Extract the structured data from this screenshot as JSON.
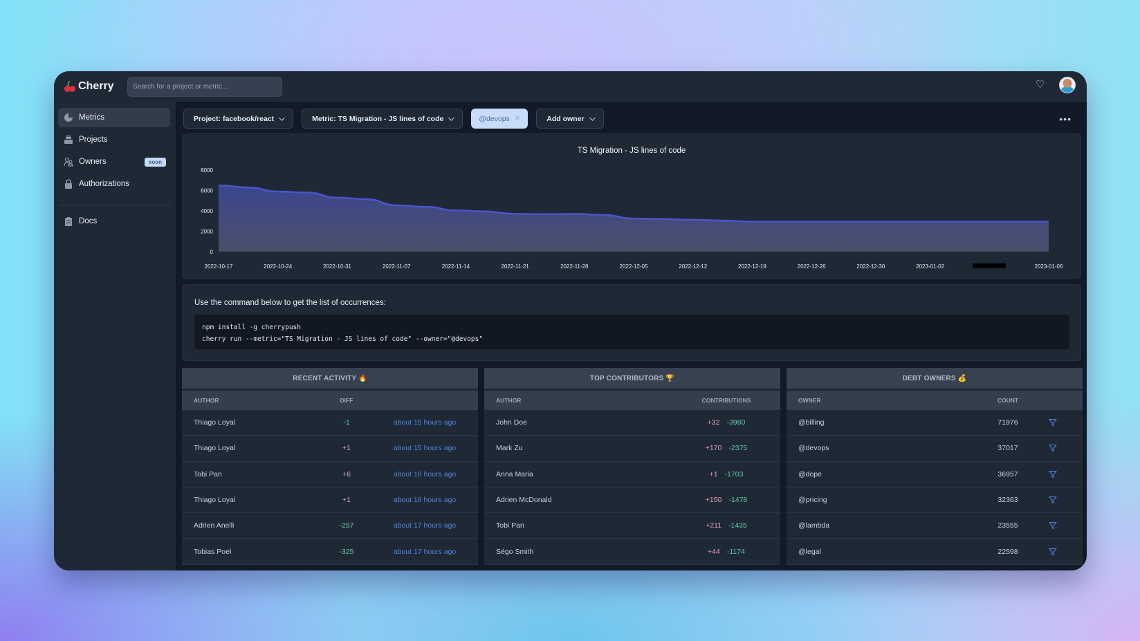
{
  "app": {
    "name": "Cherry",
    "search_placeholder": "Search for a project or metric..."
  },
  "sidebar": {
    "items": [
      {
        "label": "Metrics",
        "icon": "pie-chart-icon",
        "active": true
      },
      {
        "label": "Projects",
        "icon": "stack-icon"
      },
      {
        "label": "Owners",
        "icon": "users-icon",
        "badge": "soon"
      },
      {
        "label": "Authorizations",
        "icon": "lock-icon"
      },
      {
        "label": "Docs",
        "icon": "clipboard-icon"
      }
    ]
  },
  "filters": {
    "project": "Project: facebook/react",
    "metric": "Metric: TS Migration - JS lines of code",
    "owner_tag": "@devops",
    "add_owner": "Add owner",
    "more": "•••"
  },
  "chart_data": {
    "type": "area",
    "title": "TS Migration - JS lines of code",
    "xlabel": "",
    "ylabel": "",
    "ylim": [
      0,
      8000
    ],
    "yticks": [
      0,
      2000,
      4000,
      6000,
      8000
    ],
    "xticks": [
      "2022-10-17",
      "2022-10-24",
      "2022-10-31",
      "2022-11-07",
      "2022-11-14",
      "2022-11-21",
      "2022-11-28",
      "2022-12-05",
      "2022-12-12",
      "2022-12-19",
      "2022-12-26",
      "2022-12-30",
      "2023-01-02",
      "[redacted]",
      "2023-01-06"
    ],
    "series": [
      {
        "name": "JS lines of code",
        "color": "#4a55c9",
        "x": [
          0,
          0.5,
          1,
          1.5,
          2,
          2.5,
          3,
          3.5,
          4,
          4.5,
          5,
          5.5,
          6,
          6.5,
          7,
          7.5,
          8,
          8.5,
          9,
          9.5,
          10,
          10.5,
          11,
          11.5,
          12,
          12.5,
          13,
          13.5,
          14
        ],
        "values": [
          6500,
          6300,
          5900,
          5800,
          5300,
          5150,
          4550,
          4400,
          4050,
          3950,
          3700,
          3680,
          3700,
          3600,
          3250,
          3200,
          3130,
          3050,
          2950,
          2950,
          2950,
          2950,
          2950,
          2950,
          2950,
          2950,
          2950,
          2950,
          2950
        ]
      }
    ],
    "grid": false,
    "legend": "none"
  },
  "command": {
    "intro": "Use the command below to get the list of occurrences:",
    "lines": [
      "npm install -g cherrypush",
      "cherry run --metric=\"TS Migration - JS lines of code\" --owner=\"@devops\""
    ]
  },
  "recent_activity": {
    "title": "RECENT ACTIVITY 🔥",
    "columns": [
      "AUTHOR",
      "DIFF",
      ""
    ],
    "rows": [
      {
        "author": "Thiago Loyal",
        "diff": "-1",
        "time": "about 15 hours ago"
      },
      {
        "author": "Thiago Loyal",
        "diff": "+1",
        "time": "about 15 hours ago"
      },
      {
        "author": "Tobi Pan",
        "diff": "+6",
        "time": "about 16 hours ago"
      },
      {
        "author": "Thiago Loyal",
        "diff": "+1",
        "time": "about 16 hours ago"
      },
      {
        "author": "Adrien Anelli",
        "diff": "-257",
        "time": "about 17 hours ago"
      },
      {
        "author": "Tobias Poel",
        "diff": "-325",
        "time": "about 17 hours ago"
      }
    ]
  },
  "top_contributors": {
    "title": "TOP CONTRIBUTORS 🏆",
    "columns": [
      "AUTHOR",
      "CONTRIBUTIONS"
    ],
    "rows": [
      {
        "author": "John Doe",
        "added": "+32",
        "removed": "-3980"
      },
      {
        "author": "Mark Zu",
        "added": "+170",
        "removed": "-2375"
      },
      {
        "author": "Anna Maria",
        "added": "+1",
        "removed": "-1703"
      },
      {
        "author": "Adrien McDonald",
        "added": "+150",
        "removed": "-1478"
      },
      {
        "author": "Tobi Pan",
        "added": "+211",
        "removed": "-1435"
      },
      {
        "author": "Ségo Smith",
        "added": "+44",
        "removed": "-1174"
      }
    ]
  },
  "debt_owners": {
    "title": "DEBT OWNERS 💰",
    "columns": [
      "OWNER",
      "COUNT",
      ""
    ],
    "rows": [
      {
        "owner": "@billing",
        "count": "71976"
      },
      {
        "owner": "@devops",
        "count": "37017"
      },
      {
        "owner": "@dope",
        "count": "36957"
      },
      {
        "owner": "@pricing",
        "count": "32363"
      },
      {
        "owner": "@lambda",
        "count": "23555"
      },
      {
        "owner": "@legal",
        "count": "22598"
      }
    ]
  },
  "colors": {
    "accent": "#4a55c9",
    "positive_diff": "#e2a1b9",
    "negative_diff": "#5ecaa0",
    "link": "#4f83d9"
  }
}
